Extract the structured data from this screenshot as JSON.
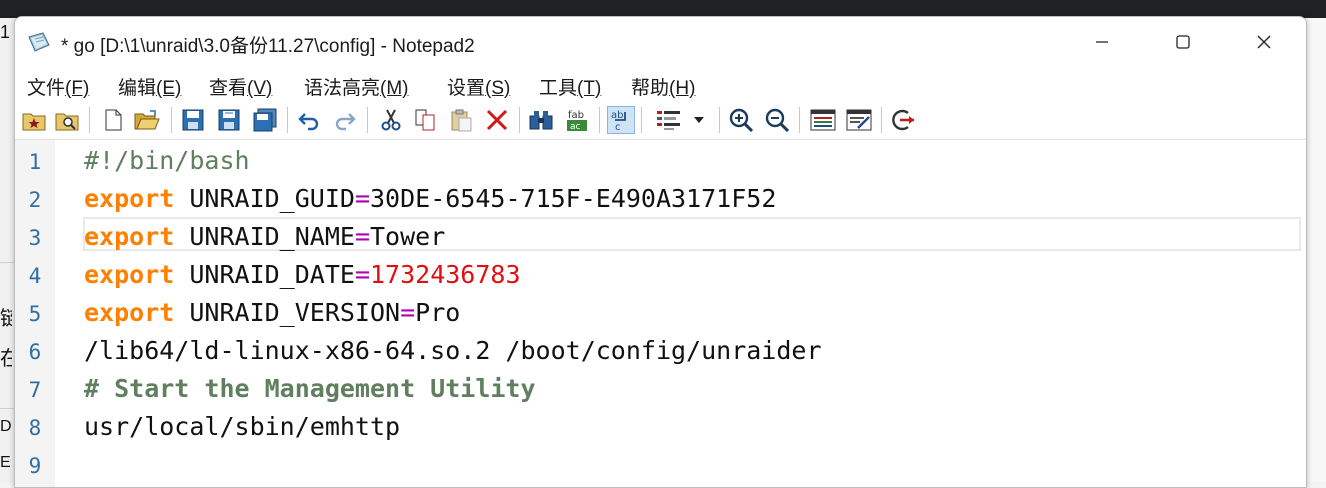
{
  "window": {
    "title": "* go [D:\\1\\unraid\\3.0备份11.27\\config] - Notepad2",
    "controls": {
      "minimize": "minimize",
      "maximize": "maximize",
      "close": "close"
    }
  },
  "menu": [
    {
      "label": "文件",
      "key": "(F)"
    },
    {
      "label": "编辑",
      "key": "(E)"
    },
    {
      "label": "查看",
      "key": "(V)"
    },
    {
      "label": "语法高亮",
      "key": "(M)"
    },
    {
      "label": "设置",
      "key": "(S)"
    },
    {
      "label": "工具",
      "key": "(T)"
    },
    {
      "label": "帮助",
      "key": "(H)"
    }
  ],
  "toolbar": [
    "favorites-icon",
    "find-file-icon",
    "new-file-icon",
    "open-file-icon",
    "save-icon",
    "save-as-icon",
    "save-copy-icon",
    "undo-icon",
    "redo-icon",
    "cut-icon",
    "copy-icon",
    "paste-icon",
    "delete-icon",
    "find-icon",
    "replace-icon",
    "word-wrap-icon",
    "scheme-icon",
    "dropdown-arrow-icon",
    "zoom-in-icon",
    "zoom-out-icon",
    "schemes-icon",
    "customize-icon",
    "exit-icon"
  ],
  "editor": {
    "line_numbers": [
      "1",
      "2",
      "3",
      "4",
      "5",
      "6",
      "7",
      "8",
      "9"
    ],
    "lines": [
      [
        {
          "t": "#!/bin/bash",
          "c": "cmt-plain"
        }
      ],
      [
        {
          "t": "export",
          "c": "kw"
        },
        {
          "t": " UNRAID_GUID",
          "c": "txt"
        },
        {
          "t": "=",
          "c": "op"
        },
        {
          "t": "30DE-6545-715F-E490A3171F52",
          "c": "txt"
        }
      ],
      [
        {
          "t": "export",
          "c": "kw"
        },
        {
          "t": " UNRAID_NAME",
          "c": "txt"
        },
        {
          "t": "=",
          "c": "op"
        },
        {
          "t": "Tower",
          "c": "txt"
        }
      ],
      [
        {
          "t": "export",
          "c": "kw"
        },
        {
          "t": " UNRAID_DATE",
          "c": "txt"
        },
        {
          "t": "=",
          "c": "op"
        },
        {
          "t": "1732436783",
          "c": "num"
        }
      ],
      [
        {
          "t": "export",
          "c": "kw"
        },
        {
          "t": " UNRAID_VERSION",
          "c": "txt"
        },
        {
          "t": "=",
          "c": "op"
        },
        {
          "t": "Pro",
          "c": "txt"
        }
      ],
      [
        {
          "t": "/lib64/ld-linux-x86-64.so.2 /boot/config/unraider",
          "c": "txt"
        }
      ],
      [
        {
          "t": "# Start the Management Utility",
          "c": "cmt"
        }
      ],
      [
        {
          "t": "usr/local/sbin/emhttp",
          "c": "txt"
        }
      ],
      []
    ],
    "current_line": 3
  },
  "background": {
    "fragments": [
      "1",
      "链",
      "在",
      "D",
      "E"
    ]
  },
  "colors": {
    "keyword": "#ff8000",
    "operator": "#b000b0",
    "number": "#e01010",
    "comment": "#5f7f5f",
    "line_number": "#2f6ea3"
  }
}
